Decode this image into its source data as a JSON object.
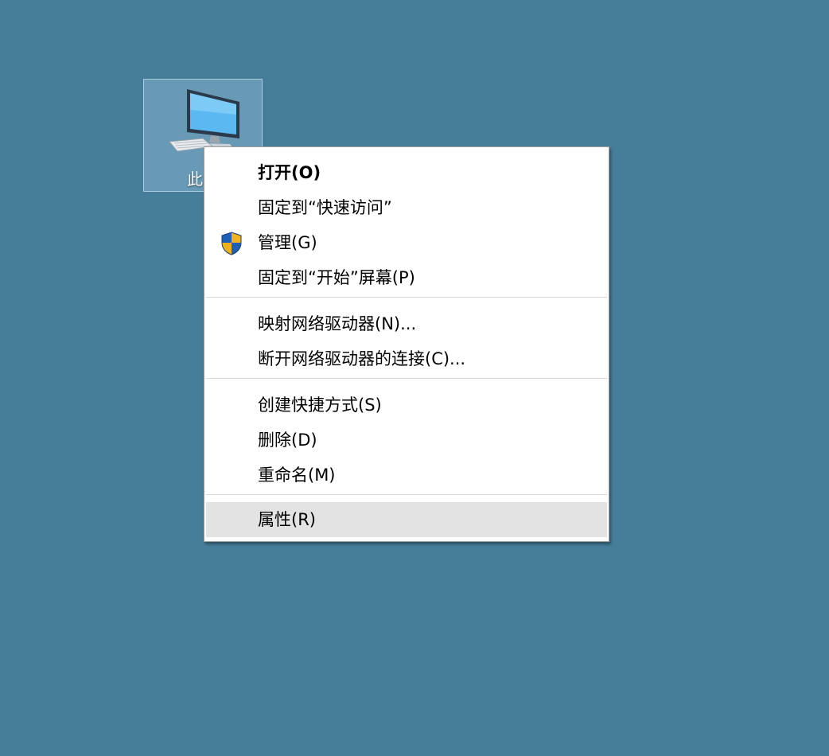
{
  "desktop": {
    "icon": {
      "label": "此电",
      "icon_name": "computer-icon"
    }
  },
  "context_menu": {
    "items": [
      {
        "label": "打开(O)",
        "bold": true
      },
      {
        "label": "固定到“快速访问”"
      },
      {
        "label": "管理(G)",
        "icon": "uac-shield-icon"
      },
      {
        "label": "固定到“开始”屏幕(P)"
      },
      {
        "label": "映射网络驱动器(N)..."
      },
      {
        "label": "断开网络驱动器的连接(C)..."
      },
      {
        "label": "创建快捷方式(S)"
      },
      {
        "label": "删除(D)"
      },
      {
        "label": "重命名(M)"
      },
      {
        "label": "属性(R)",
        "highlighted": true
      }
    ]
  },
  "colors": {
    "desktop_background": "#467d98",
    "menu_background": "#ffffff",
    "highlight": "#e3e3e3",
    "shield_blue": "#1f5fb5",
    "shield_yellow": "#f2b21c"
  }
}
